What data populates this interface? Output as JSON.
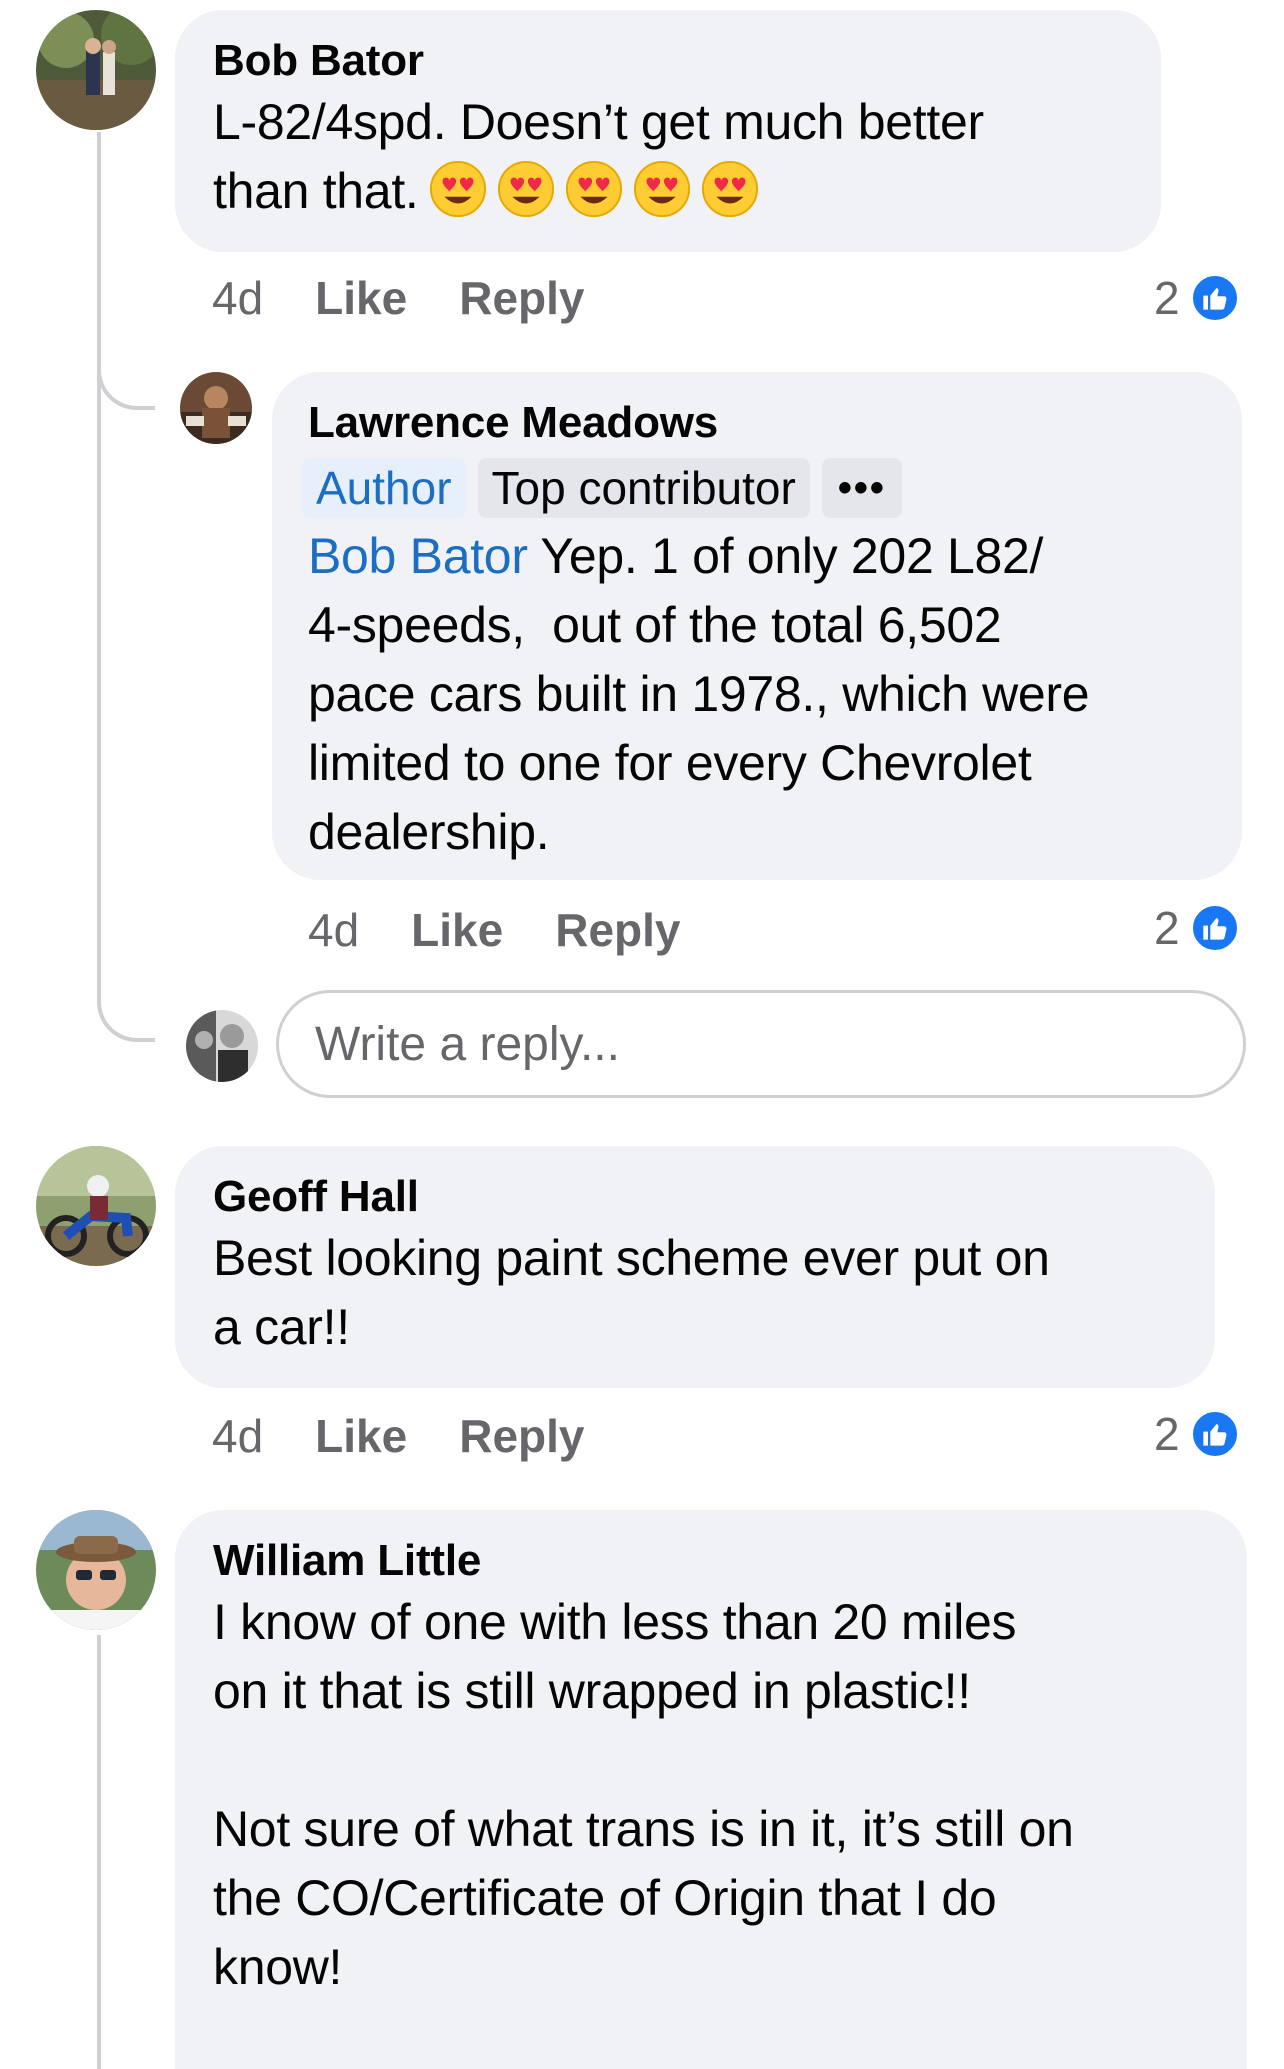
{
  "comments": [
    {
      "author": "Bob Bator",
      "text": "L-82/4spd. Doesn’t get much better\nthan that.",
      "emoji": [
        "heart-eyes-emoji",
        "heart-eyes-emoji",
        "heart-eyes-emoji",
        "heart-eyes-emoji",
        "heart-eyes-emoji"
      ],
      "time": "4d",
      "like_label": "Like",
      "reply_label": "Reply",
      "reactions": "2"
    },
    {
      "author": "Lawrence Meadows",
      "badges": {
        "author": "Author",
        "top": "Top contributor",
        "more": "•••"
      },
      "mention": "Bob Bator",
      "text": " Yep. 1 of only 202 L82/\n4-speeds,  out of the total 6,502\npace cars built in 1978., which were\nlimited to one for every Chevrolet\ndealership.",
      "time": "4d",
      "like_label": "Like",
      "reply_label": "Reply",
      "reactions": "2"
    },
    {
      "author": "Geoff Hall",
      "text": "Best looking paint scheme ever put on\na car!!",
      "time": "4d",
      "like_label": "Like",
      "reply_label": "Reply",
      "reactions": "2"
    },
    {
      "author": "William Little",
      "text": "I know of one with less than 20 miles\non it that is still wrapped in plastic!!\n\nNot sure of what trans is in it, it’s still on\nthe CO/Certificate of Origin that I do\nknow!"
    }
  ],
  "reply_box": {
    "placeholder": "Write a reply..."
  },
  "colors": {
    "bubble": "#f0f2f5",
    "mention": "#1b6ec2",
    "like_blue": "#1877f2",
    "meta_gray": "#65676b"
  }
}
